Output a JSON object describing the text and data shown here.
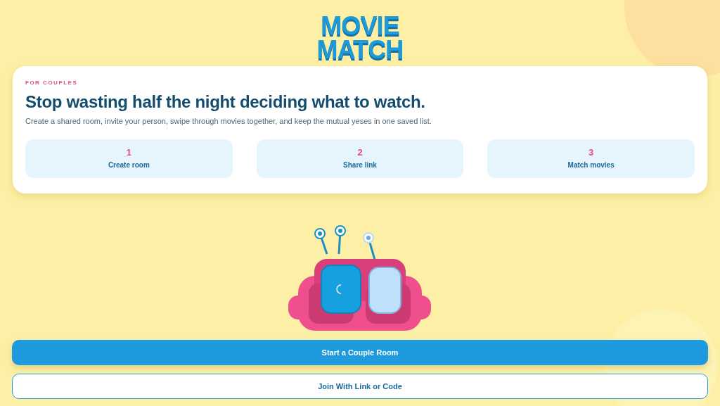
{
  "logo": {
    "lines": [
      "MOVIE",
      "MATCH"
    ]
  },
  "intro": {
    "eyebrow": "FOR COUPLES",
    "headline": "Stop wasting half the night deciding what to watch.",
    "description": "Create a shared room, invite your person, swipe through movies together, and keep the mutual yeses in one saved list.",
    "steps": [
      {
        "number": "1",
        "label": "Create room"
      },
      {
        "number": "2",
        "label": "Share link"
      },
      {
        "number": "3",
        "label": "Match movies"
      }
    ]
  },
  "actions": [
    {
      "kind": "primary",
      "label": "Start a Couple Room"
    },
    {
      "kind": "secondary",
      "label": "Join With Link or Code"
    }
  ]
}
